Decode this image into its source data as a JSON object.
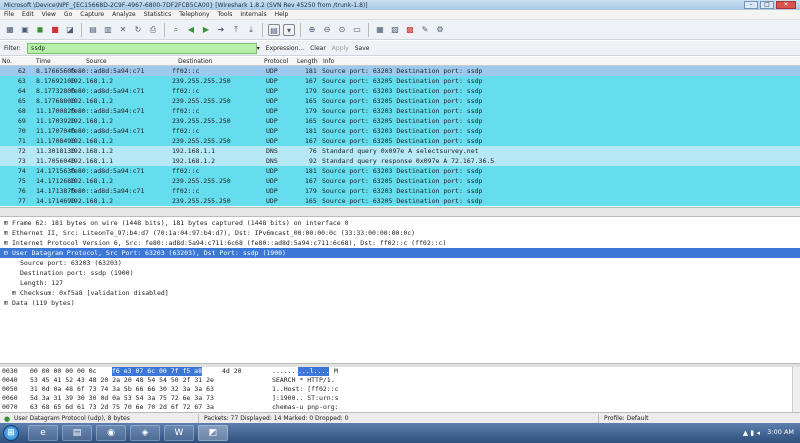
{
  "window": {
    "title": "Microsoft \\Device\\NPF_{EC15668D-2C9F-4967-6800-7DF2FCB5CA00}   [Wireshark 1.8.2 (SVN Rev 45250 from /trunk-1.8)]",
    "buttons": {
      "minimize": "–",
      "maximize": "□",
      "close": "✕"
    }
  },
  "menu": [
    "File",
    "Edit",
    "View",
    "Go",
    "Capture",
    "Analyze",
    "Statistics",
    "Telephony",
    "Tools",
    "Internals",
    "Help"
  ],
  "toolbar_icons": [
    "interfaces-icon",
    "options-icon",
    "start-icon",
    "stop-icon",
    "restart-icon",
    "open-icon",
    "save-icon",
    "close-icon",
    "reload-icon",
    "print-icon",
    "find-icon",
    "back-icon",
    "forward-icon",
    "goto-icon",
    "first-icon",
    "last-icon",
    "colorize-icon",
    "autoscroll-icon",
    "zoom-in-icon",
    "zoom-out-icon",
    "zoom-normal-icon",
    "resize-columns-icon",
    "capture-filters-icon",
    "display-filters-icon",
    "coloring-rules-icon",
    "preferences-icon",
    "help-icon"
  ],
  "filter": {
    "label": "Filter:",
    "value": "ssdp",
    "dropdown": "▾",
    "expression": "Expression...",
    "clear": "Clear",
    "apply": "Apply",
    "save": "Save"
  },
  "columns": {
    "no": "No.",
    "time": "Time",
    "source": "Source",
    "destination": "Destination",
    "protocol": "Protocol",
    "length": "Length",
    "info": "Info"
  },
  "packets": [
    {
      "no": "62",
      "time": "8.17665600",
      "src": "fe80::ad8d:5a94:c71",
      "dst": "ff02::c",
      "proto": "UDP",
      "len": "181",
      "info": "Source port: 63203  Destination port: ssdp",
      "kind": "sel"
    },
    {
      "no": "63",
      "time": "8.17692100",
      "src": "192.168.1.2",
      "dst": "239.255.255.250",
      "proto": "UDP",
      "len": "167",
      "info": "Source port: 63205  Destination port: ssdp",
      "kind": "udp"
    },
    {
      "no": "64",
      "time": "8.17732800",
      "src": "fe80::ad8d:5a94:c71",
      "dst": "ff02::c",
      "proto": "UDP",
      "len": "179",
      "info": "Source port: 63203  Destination port: ssdp",
      "kind": "udp"
    },
    {
      "no": "65",
      "time": "8.17768800",
      "src": "192.168.1.2",
      "dst": "239.255.255.250",
      "proto": "UDP",
      "len": "165",
      "info": "Source port: 63205  Destination port: ssdp",
      "kind": "udp"
    },
    {
      "no": "68",
      "time": "11.1700820",
      "src": "fe80::ad8d:5a94:c71",
      "dst": "ff02::c",
      "proto": "UDP",
      "len": "179",
      "info": "Source port: 63203  Destination port: ssdp",
      "kind": "udp"
    },
    {
      "no": "69",
      "time": "11.1703920",
      "src": "192.168.1.2",
      "dst": "239.255.255.250",
      "proto": "UDP",
      "len": "165",
      "info": "Source port: 63205  Destination port: ssdp",
      "kind": "udp"
    },
    {
      "no": "70",
      "time": "11.1707040",
      "src": "fe80::ad8d:5a94:c71",
      "dst": "ff02::c",
      "proto": "UDP",
      "len": "181",
      "info": "Source port: 63203  Destination port: ssdp",
      "kind": "udp"
    },
    {
      "no": "71",
      "time": "11.1708490",
      "src": "192.168.1.2",
      "dst": "239.255.255.250",
      "proto": "UDP",
      "len": "167",
      "info": "Source port: 63205  Destination port: ssdp",
      "kind": "udp"
    },
    {
      "no": "72",
      "time": "11.3018130",
      "src": "192.168.1.2",
      "dst": "192.168.1.1",
      "proto": "DNS",
      "len": "76",
      "info": "Standard query 0x097e  A selectsurvey.net",
      "kind": "dns"
    },
    {
      "no": "73",
      "time": "11.7056040",
      "src": "192.168.1.1",
      "dst": "192.168.1.2",
      "proto": "DNS",
      "len": "92",
      "info": "Standard query response 0x097e  A 72.167.36.5",
      "kind": "dns"
    },
    {
      "no": "74",
      "time": "14.1715630",
      "src": "fe80::ad8d:5a94:c71",
      "dst": "ff02::c",
      "proto": "UDP",
      "len": "181",
      "info": "Source port: 63203  Destination port: ssdp",
      "kind": "udp"
    },
    {
      "no": "75",
      "time": "14.1712680",
      "src": "192.168.1.2",
      "dst": "239.255.255.250",
      "proto": "UDP",
      "len": "167",
      "info": "Source port: 63205  Destination port: ssdp",
      "kind": "udp"
    },
    {
      "no": "76",
      "time": "14.1713870",
      "src": "fe80::ad8d:5a94:c71",
      "dst": "ff02::c",
      "proto": "UDP",
      "len": "179",
      "info": "Source port: 63203  Destination port: ssdp",
      "kind": "udp"
    },
    {
      "no": "77",
      "time": "14.1714690",
      "src": "192.168.1.2",
      "dst": "239.255.255.250",
      "proto": "UDP",
      "len": "165",
      "info": "Source port: 63205  Destination port: ssdp",
      "kind": "udp"
    }
  ],
  "details": [
    {
      "text": "Frame 62: 181 bytes on wire (1448 bits), 181 bytes captured (1448 bits) on interface 0",
      "exp": "⊞",
      "child": false,
      "hl": false
    },
    {
      "text": "Ethernet II, Src: LiteonTe_97:b4:d7 (70:1a:04:97:b4:d7), Dst: IPv6mcast_00:00:00:0c (33:33:00:00:00:0c)",
      "exp": "⊞",
      "child": false,
      "hl": false
    },
    {
      "text": "Internet Protocol Version 6, Src: fe80::ad8d:5a94:c711:6c68 (fe80::ad8d:5a94:c711:6c68), Dst: ff02::c (ff02::c)",
      "exp": "⊞",
      "child": false,
      "hl": false
    },
    {
      "text": "User Datagram Protocol, Src Port: 63203 (63203), Dst Port: ssdp (1900)",
      "exp": "⊟",
      "child": false,
      "hl": true
    },
    {
      "text": "Source port: 63203 (63203)",
      "exp": "",
      "child": true,
      "hl": false
    },
    {
      "text": "Destination port: ssdp (1900)",
      "exp": "",
      "child": true,
      "hl": false
    },
    {
      "text": "Length: 127",
      "exp": "",
      "child": true,
      "hl": false
    },
    {
      "text": "Checksum: 0xf5a8 [validation disabled]",
      "exp": "⊞",
      "child": true,
      "hl": false
    },
    {
      "text": "Data (119 bytes)",
      "exp": "⊞",
      "child": false,
      "hl": false
    }
  ],
  "bytes": [
    {
      "off": "0030",
      "hex": "00 00 00 00 00 0c",
      "hexsel": "f6 e3 07 6c 00 7f f5 a8",
      "hex2": "4d 20",
      "ascii": "......",
      "asciisel": "...l....",
      "ascii2": "M "
    },
    {
      "off": "0040",
      "hex": "53 45 41 52 43 48 20 2a 20 48 54 54 50 2f 31 2e",
      "hexsel": "",
      "hex2": "",
      "ascii": "SEARCH * HTTP/1.",
      "asciisel": "",
      "ascii2": ""
    },
    {
      "off": "0050",
      "hex": "31 0d 0a 48 6f 73 74 3a 5b 66 66 30 32 3a 3a 63",
      "hexsel": "",
      "hex2": "",
      "ascii": "1..Host: [ff02::c",
      "asciisel": "",
      "ascii2": ""
    },
    {
      "off": "0060",
      "hex": "5d 3a 31 39 30 30 0d 0a 53 54 3a 75 72 6e 3a 73",
      "hexsel": "",
      "hex2": "",
      "ascii": "]:1900.. ST:urn:s",
      "asciisel": "",
      "ascii2": ""
    },
    {
      "off": "0070",
      "hex": "63 68 65 6d 61 73 2d 75 70 6e 70 2d 6f 72 67 3a",
      "hexsel": "",
      "hex2": "",
      "ascii": "chemas-u pnp-org:",
      "asciisel": "",
      "ascii2": ""
    }
  ],
  "status": {
    "field": "User Datagram Protocol (udp), 8 bytes",
    "packets": "Packets: 77 Displayed: 14 Marked: 0 Dropped: 0",
    "profile": "Profile: Default"
  },
  "taskbar": {
    "start": "⊞",
    "apps": [
      "e",
      "▤",
      "◉",
      "◈",
      "W",
      "◩"
    ],
    "tray": "▲ ▮ ◂",
    "clock": "3:00 AM"
  }
}
